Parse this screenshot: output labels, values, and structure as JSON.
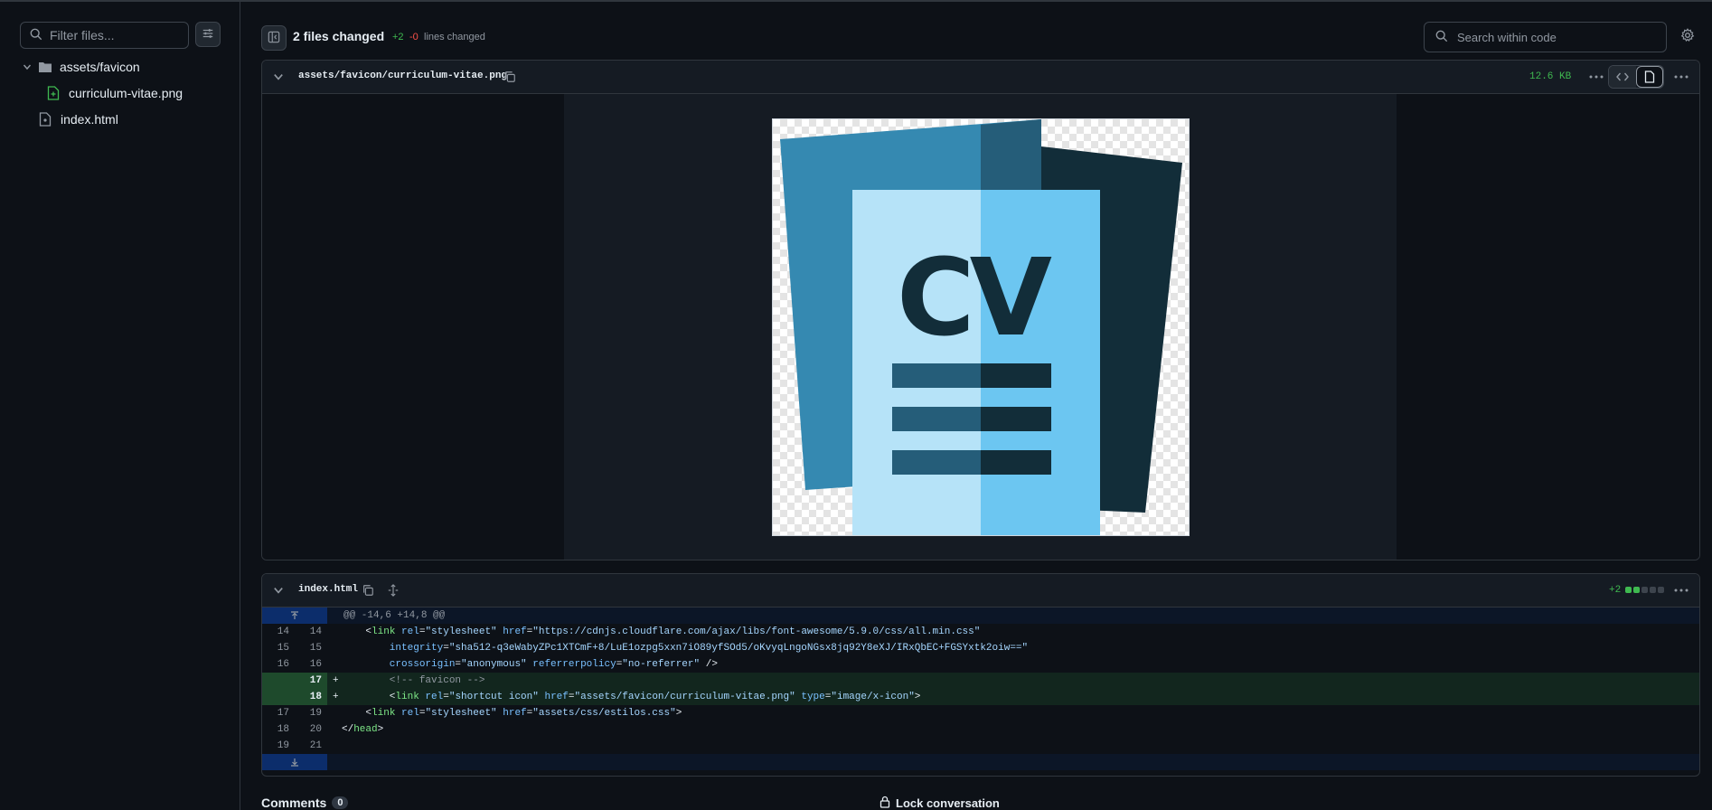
{
  "sidebar": {
    "filter_placeholder": "Filter files...",
    "tree": [
      {
        "label": "assets/favicon"
      },
      {
        "label": "curriculum-vitae.png"
      },
      {
        "label": "index.html"
      }
    ]
  },
  "header": {
    "files_changed": "2 files changed",
    "additions": "+2",
    "deletions": "-0",
    "lines_changed": "lines changed",
    "search_placeholder": "Search within code"
  },
  "file1": {
    "path": "assets/favicon/curriculum-vitae.png",
    "size": "12.6 KB",
    "image_alt": "CV"
  },
  "file2": {
    "path": "index.html",
    "additions": "+2",
    "hunk_header": "@@ -14,6 +14,8 @@"
  },
  "diff_lines": [
    {
      "old": "14",
      "new": "14",
      "sign": "",
      "type": "ctx"
    },
    {
      "old": "15",
      "new": "15",
      "sign": "",
      "type": "ctx"
    },
    {
      "old": "16",
      "new": "16",
      "sign": "",
      "type": "ctx"
    },
    {
      "old": "",
      "new": "17",
      "sign": "+",
      "type": "add"
    },
    {
      "old": "",
      "new": "18",
      "sign": "+",
      "type": "add"
    },
    {
      "old": "17",
      "new": "19",
      "sign": "",
      "type": "ctx"
    },
    {
      "old": "18",
      "new": "20",
      "sign": "",
      "type": "ctx"
    },
    {
      "old": "19",
      "new": "21",
      "sign": "",
      "type": "ctx"
    }
  ],
  "code": {
    "l1_a": "    <",
    "l1_tag": "link",
    "l1_attr1": " rel",
    "l1_eq1": "=",
    "l1_val1": "\"stylesheet\"",
    "l1_attr2": " href",
    "l1_eq2": "=",
    "l1_val2": "\"https://cdnjs.cloudflare.com/ajax/libs/font-awesome/5.9.0/css/all.min.css\"",
    "l2_attr": "        integrity",
    "l2_eq": "=",
    "l2_val": "\"sha512-q3eWabyZPc1XTCmF+8/LuE1ozpg5xxn7iO89yfSOd5/oKvyqLngoNGsx8jq92Y8eXJ/IRxQbEC+FGSYxtk2oiw==\"",
    "l3_attr1": "        crossorigin",
    "l3_eq1": "=",
    "l3_val1": "\"anonymous\"",
    "l3_attr2": " referrerpolicy",
    "l3_eq2": "=",
    "l3_val2": "\"no-referrer\"",
    "l3_end": " />",
    "l4_comment": "        <!-- favicon -->",
    "l5_a": "        <",
    "l5_tag": "link",
    "l5_attr1": " rel",
    "l5_eq1": "=",
    "l5_val1": "\"shortcut icon\"",
    "l5_attr2": " href",
    "l5_eq2": "=",
    "l5_val2": "\"assets/favicon/curriculum-vitae.png\"",
    "l5_attr3": " type",
    "l5_eq3": "=",
    "l5_val3": "\"image/x-icon\"",
    "l5_end": ">",
    "l6_a": "    <",
    "l6_tag": "link",
    "l6_attr1": " rel",
    "l6_eq1": "=",
    "l6_val1": "\"stylesheet\"",
    "l6_attr2": " href",
    "l6_eq2": "=",
    "l6_val2": "\"assets/css/estilos.css\"",
    "l6_end": ">",
    "l7_a": "</",
    "l7_tag": "head",
    "l7_end": ">"
  },
  "footer": {
    "comments_label": "Comments",
    "comments_count": "0",
    "lock_label": "Lock conversation"
  },
  "colors": {
    "accent_green": "#3fb950",
    "accent_red": "#f85149",
    "cv_dark": "#3589b1",
    "cv_darker": "#122d39",
    "cv_light": "#b6e3f8",
    "cv_mid": "#6cc6f1"
  }
}
